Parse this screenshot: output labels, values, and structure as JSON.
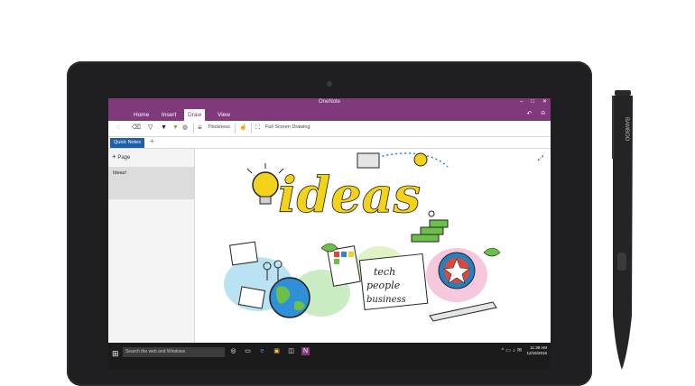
{
  "app": {
    "title": "OneNote"
  },
  "window_controls": [
    "–",
    "□",
    "✕"
  ],
  "ribbon": {
    "tabs": [
      {
        "label": "Home",
        "active": false
      },
      {
        "label": "Insert",
        "active": false
      },
      {
        "label": "Draw",
        "active": true
      },
      {
        "label": "View",
        "active": false
      }
    ]
  },
  "toolbar": {
    "thickness_label": "Thickness",
    "fullscreen_label": "Full Screen Drawing"
  },
  "notebook": {
    "section_tab": "Quick Notes",
    "add_section": "+"
  },
  "pages": {
    "add_page_label": "Page",
    "items": [
      "Ideas!"
    ]
  },
  "canvas": {
    "heading": "ideas",
    "sketch_text": [
      "tech",
      "people",
      "business"
    ]
  },
  "taskbar": {
    "search_placeholder": "Search the web and Windows",
    "time": "11:39 AM",
    "date": "12/16/2015"
  },
  "pen": {
    "brand": "BAMBOO"
  },
  "colors": {
    "onenote_purple": "#80397b",
    "section_blue": "#1e5fa8",
    "idea_yellow": "#f2d21b",
    "tablet_black": "#1f1f21"
  }
}
